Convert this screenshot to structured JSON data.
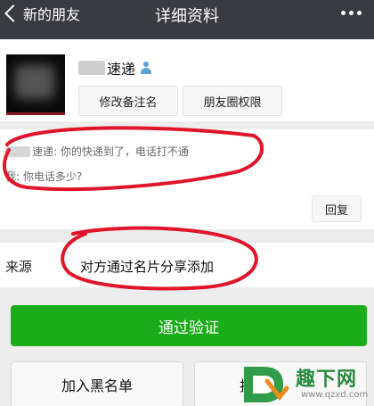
{
  "nav": {
    "back_label": "新的朋友",
    "title": "详细资料"
  },
  "profile": {
    "name": "速递",
    "remark_button": "修改备注名",
    "moments_button": "朋友圈权限"
  },
  "messages": [
    {
      "text": "速递: 你的快递到了，电话打不通"
    },
    {
      "text": "我: 你电话多少?"
    }
  ],
  "reply_button": "回复",
  "source": {
    "label": "来源",
    "value": "对方通过名片分享添加"
  },
  "verify_button": "通过验证",
  "blacklist_button": "加入黑名单",
  "report_button": "投诉",
  "watermark": {
    "text": "趣下网",
    "url": "www.qzxd.com"
  },
  "colors": {
    "navbar": "#3a3b40",
    "accent_green": "#1aad19",
    "annotation_red": "#e0152a"
  }
}
